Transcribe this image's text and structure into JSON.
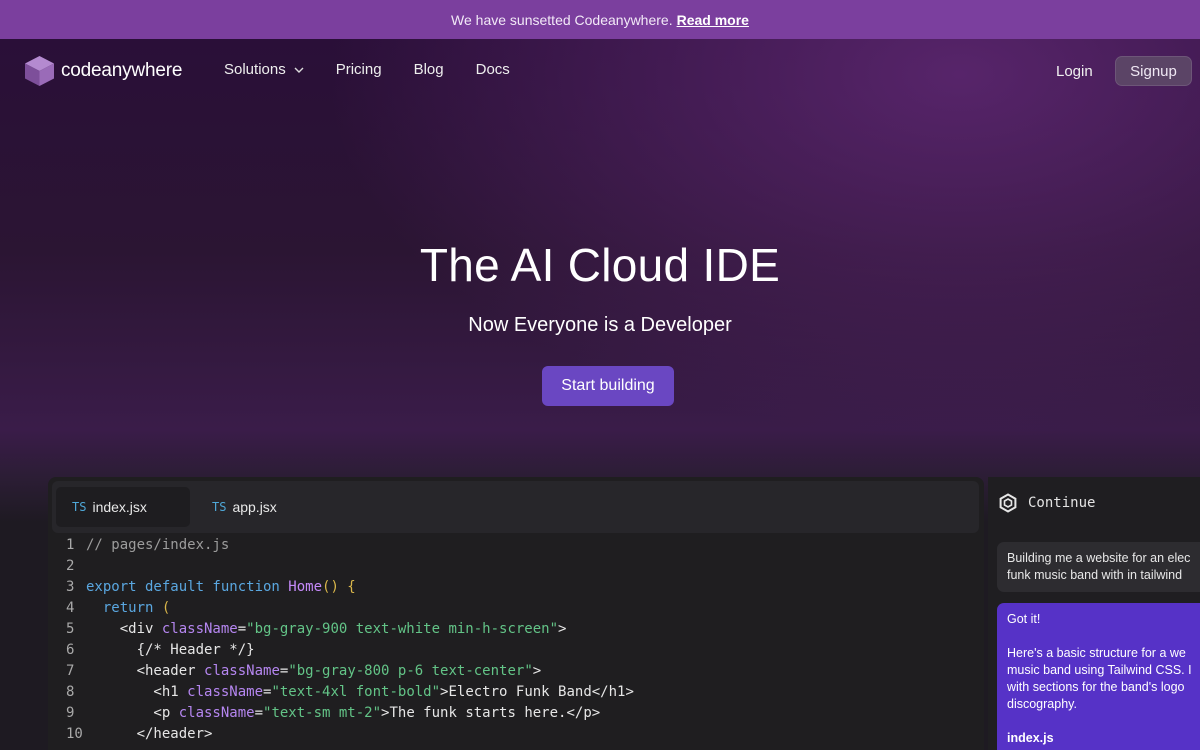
{
  "banner": {
    "text": "We have sunsetted Codeanywhere.",
    "link": "Read more"
  },
  "nav": {
    "brand": "codeanywhere",
    "links": [
      "Solutions",
      "Pricing",
      "Blog",
      "Docs"
    ],
    "login": "Login",
    "signup": "Signup"
  },
  "hero": {
    "title": "The AI Cloud IDE",
    "subtitle": "Now Everyone is a Developer",
    "cta": "Start building"
  },
  "editor": {
    "tabs": [
      {
        "lang": "TS",
        "name": "index.jsx"
      },
      {
        "lang": "TS",
        "name": "app.jsx"
      }
    ],
    "lines": [
      {
        "n": "1",
        "tokens": [
          {
            "t": "// pages/index.js",
            "c": "c-comment"
          }
        ]
      },
      {
        "n": "2",
        "tokens": []
      },
      {
        "n": "3",
        "tokens": [
          {
            "t": "export default function ",
            "c": "c-kw"
          },
          {
            "t": "Home",
            "c": "c-fn"
          },
          {
            "t": "() {",
            "c": "c-par"
          }
        ]
      },
      {
        "n": "4",
        "tokens": [
          {
            "t": "  return ",
            "c": "c-kw"
          },
          {
            "t": "(",
            "c": "c-par"
          }
        ]
      },
      {
        "n": "5",
        "tokens": [
          {
            "t": "    <div ",
            "c": ""
          },
          {
            "t": "className",
            "c": "c-attr"
          },
          {
            "t": "=",
            "c": ""
          },
          {
            "t": "\"bg-gray-900 text-white min-h-screen\"",
            "c": "c-str"
          },
          {
            "t": ">",
            "c": ""
          }
        ]
      },
      {
        "n": "6",
        "tokens": [
          {
            "t": "      {/* Header */}",
            "c": ""
          }
        ]
      },
      {
        "n": "7",
        "tokens": [
          {
            "t": "      <header ",
            "c": ""
          },
          {
            "t": "className",
            "c": "c-attr"
          },
          {
            "t": "=",
            "c": ""
          },
          {
            "t": "\"bg-gray-800 p-6 text-center\"",
            "c": "c-str"
          },
          {
            "t": ">",
            "c": ""
          }
        ]
      },
      {
        "n": "8",
        "tokens": [
          {
            "t": "        <h1 ",
            "c": ""
          },
          {
            "t": "className",
            "c": "c-attr"
          },
          {
            "t": "=",
            "c": ""
          },
          {
            "t": "\"text-4xl font-bold\"",
            "c": "c-str"
          },
          {
            "t": ">Electro Funk Band</h1>",
            "c": ""
          }
        ]
      },
      {
        "n": "9",
        "tokens": [
          {
            "t": "        <p ",
            "c": ""
          },
          {
            "t": "className",
            "c": "c-attr"
          },
          {
            "t": "=",
            "c": ""
          },
          {
            "t": "\"text-sm mt-2\"",
            "c": "c-str"
          },
          {
            "t": ">The funk starts here.</p>",
            "c": ""
          }
        ]
      },
      {
        "n": "10",
        "tokens": [
          {
            "t": "      </header>",
            "c": ""
          }
        ]
      }
    ]
  },
  "assistant": {
    "title": "Continue",
    "user_message_lines": [
      "Building me a website for an elec",
      "funk music band with in tailwind"
    ],
    "ai_reply": {
      "p1": "Got it!",
      "p2_lines": [
        "Here's a basic structure for a we",
        "music band using Tailwind CSS. I",
        "with sections for the band's logo",
        "discography."
      ],
      "file": "index.js"
    }
  },
  "colors": {
    "banner": "#7b3f9e",
    "cta": "#6a47c2",
    "ai_bubble": "#5632c7",
    "signup": "#5b4466"
  }
}
